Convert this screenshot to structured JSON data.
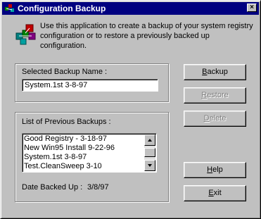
{
  "window": {
    "title": "Configuration Backup",
    "close_glyph": "×"
  },
  "intro": {
    "icon": "registry-cubes-icon",
    "text": "Use this application to create a backup of your system registry configuration or to restore a previously backed up configuration."
  },
  "backup_name": {
    "label": "Selected Backup Name :",
    "value": "System.1st 3-8-97"
  },
  "previous": {
    "label": "List of Previous Backups :",
    "items": [
      "Good Registry - 3-18-97",
      "New Win95 Install 9-22-96",
      "System.1st 3-8-97",
      "Test.CleanSweep 3-10"
    ],
    "date_label": "Date Backed Up :",
    "date_value": "3/8/97"
  },
  "buttons": {
    "backup": {
      "mnemonic": "B",
      "rest": "ackup",
      "enabled": true
    },
    "restore": {
      "mnemonic": "R",
      "rest": "estore",
      "enabled": false
    },
    "delete": {
      "mnemonic": "D",
      "rest": "elete",
      "enabled": false
    },
    "help": {
      "mnemonic": "H",
      "rest": "elp",
      "enabled": true
    },
    "exit": {
      "mnemonic": "E",
      "rest": "xit",
      "enabled": true
    }
  },
  "colors": {
    "face": "#c0c0c0",
    "titlebar": "#000080",
    "disabled_text": "#808080"
  }
}
